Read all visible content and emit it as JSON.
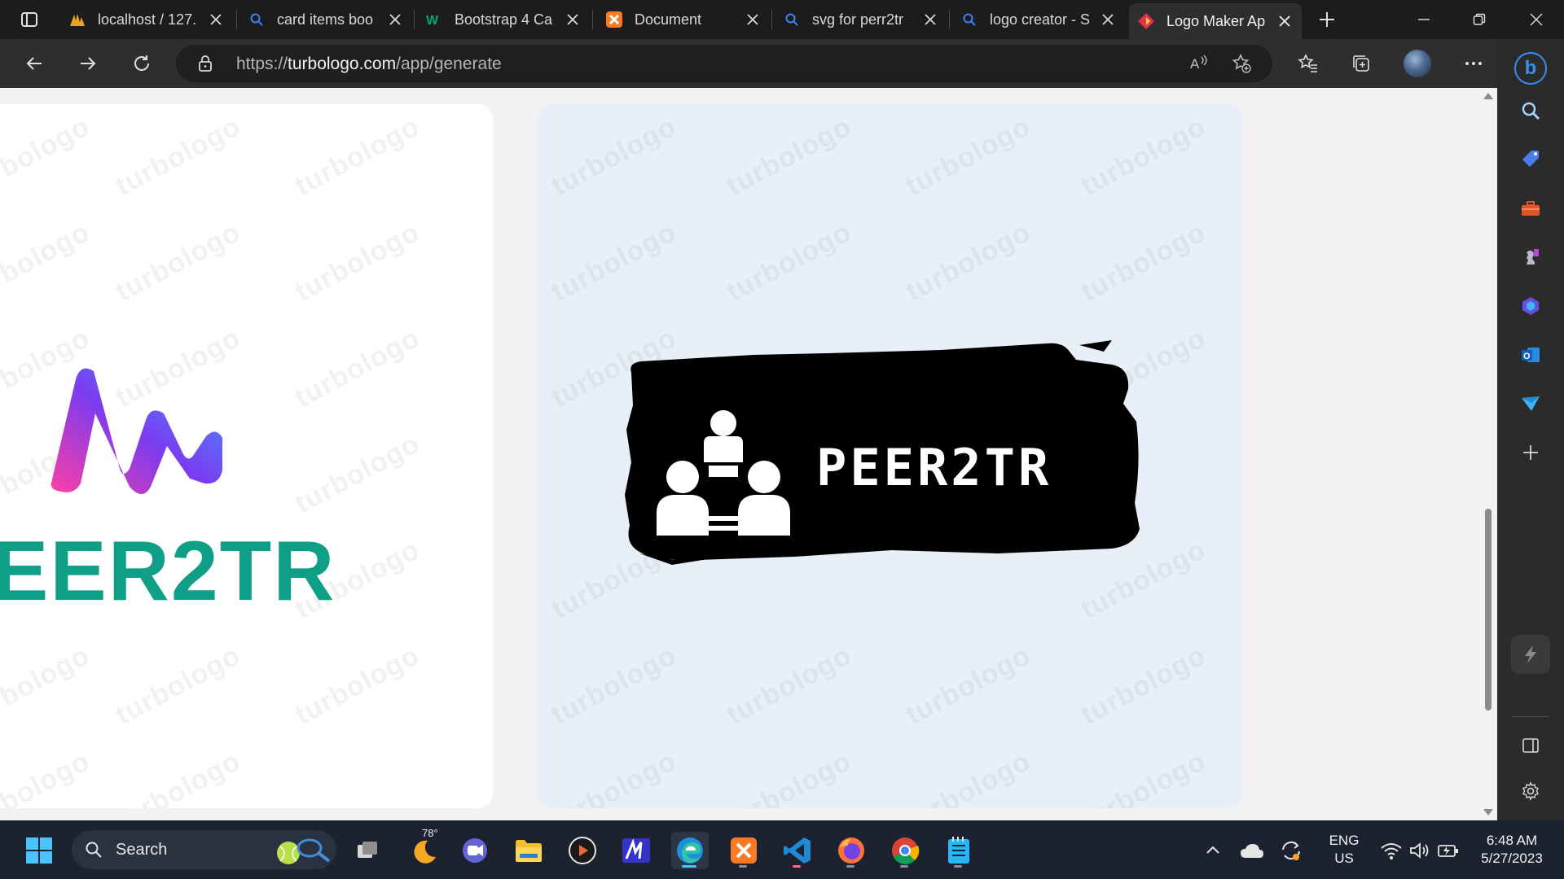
{
  "browser": {
    "tabs": [
      {
        "title": "localhost / 127.",
        "icon": "phpmyadmin-icon"
      },
      {
        "title": "card items boo",
        "icon": "search-icon"
      },
      {
        "title": "Bootstrap 4 Ca",
        "icon": "w3schools-icon"
      },
      {
        "title": "Document",
        "icon": "xampp-icon"
      },
      {
        "title": "svg for perr2tr",
        "icon": "search-icon"
      },
      {
        "title": "logo creator - S",
        "icon": "search-icon"
      },
      {
        "title": "Logo Maker Ap",
        "icon": "turbologo-icon",
        "active": true
      }
    ],
    "url_prefix": "https://",
    "url_domain": "turbologo.com",
    "url_path": "/app/generate"
  },
  "page": {
    "watermark": "turbologo",
    "logo_left_text": "EER2TR",
    "logo_right_text": "PEER2TR",
    "colors": {
      "teal": "#0e9f86",
      "gradient_start": "#ff3fa4",
      "gradient_mid": "#7a3cf0",
      "gradient_end": "#3fa0ff"
    }
  },
  "taskbar": {
    "search_label": "Search",
    "weather_temp": "78°",
    "lang_line1": "ENG",
    "lang_line2": "US",
    "time": "6:48 AM",
    "date": "5/27/2023"
  }
}
